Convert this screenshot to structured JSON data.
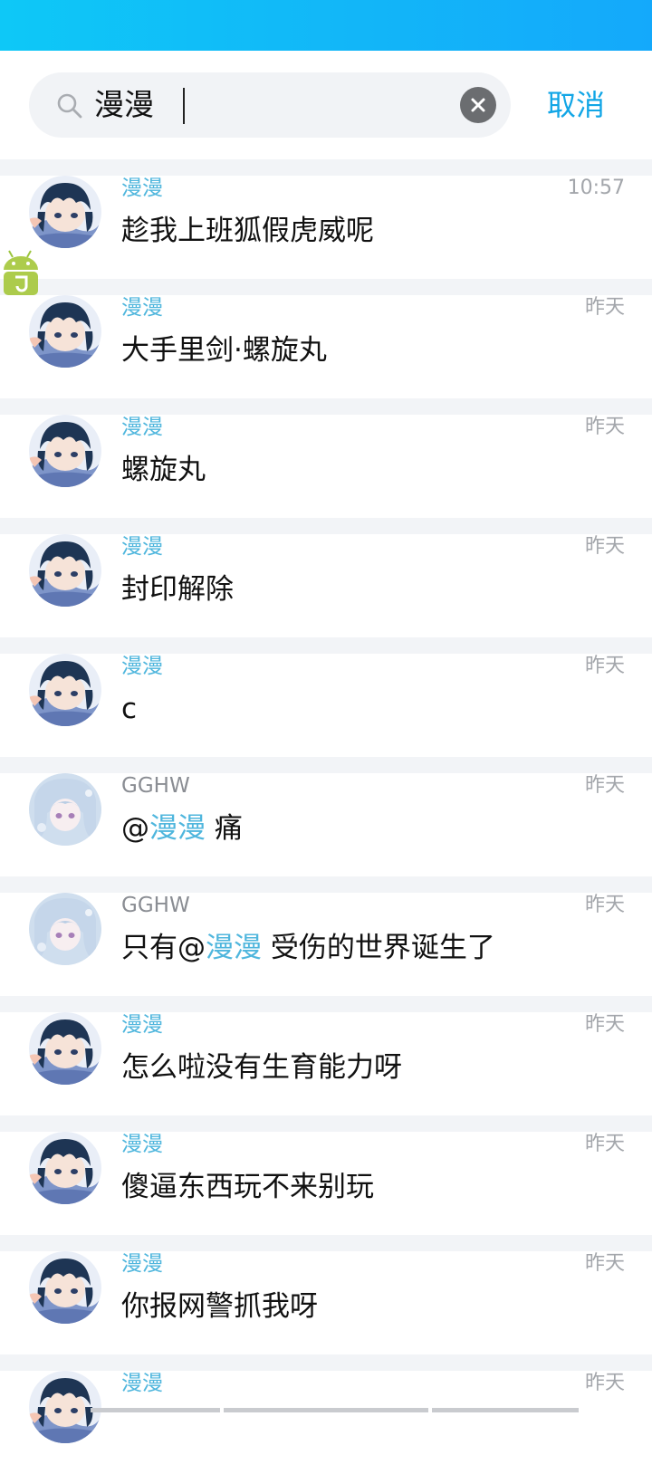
{
  "search": {
    "value": "漫漫",
    "cancel_label": "取消"
  },
  "results": [
    {
      "sender": "漫漫",
      "sender_style": "blue",
      "time": "10:57",
      "avatar": "boy",
      "message": "趁我上班狐假虎威呢"
    },
    {
      "sender": "漫漫",
      "sender_style": "blue",
      "time": "昨天",
      "avatar": "boy",
      "message": "大手里剑·螺旋丸"
    },
    {
      "sender": "漫漫",
      "sender_style": "blue",
      "time": "昨天",
      "avatar": "boy",
      "message": "螺旋丸"
    },
    {
      "sender": "漫漫",
      "sender_style": "blue",
      "time": "昨天",
      "avatar": "boy",
      "message": "封印解除"
    },
    {
      "sender": "漫漫",
      "sender_style": "blue",
      "time": "昨天",
      "avatar": "boy",
      "message": "c"
    },
    {
      "sender": "GGHW",
      "sender_style": "grey",
      "time": "昨天",
      "avatar": "girl",
      "message_pre": "@",
      "mention": "漫漫",
      "message_post": " 痛"
    },
    {
      "sender": "GGHW",
      "sender_style": "grey",
      "time": "昨天",
      "avatar": "girl",
      "message_pre": "只有@",
      "mention": "漫漫",
      "message_post": " 受伤的世界诞生了"
    },
    {
      "sender": "漫漫",
      "sender_style": "blue",
      "time": "昨天",
      "avatar": "boy",
      "message": "怎么啦没有生育能力呀"
    },
    {
      "sender": "漫漫",
      "sender_style": "blue",
      "time": "昨天",
      "avatar": "boy",
      "message": "傻逼东西玩不来别玩"
    },
    {
      "sender": "漫漫",
      "sender_style": "blue",
      "time": "昨天",
      "avatar": "boy",
      "message": "你报网警抓我呀"
    },
    {
      "sender": "漫漫",
      "sender_style": "blue",
      "time": "昨天",
      "avatar": "boy",
      "message": ""
    }
  ],
  "colors": {
    "accent": "#12a6e6",
    "sender_blue": "#4fb6dd",
    "status_bar": "#12b6f8",
    "separator": "#f2f4f7"
  }
}
